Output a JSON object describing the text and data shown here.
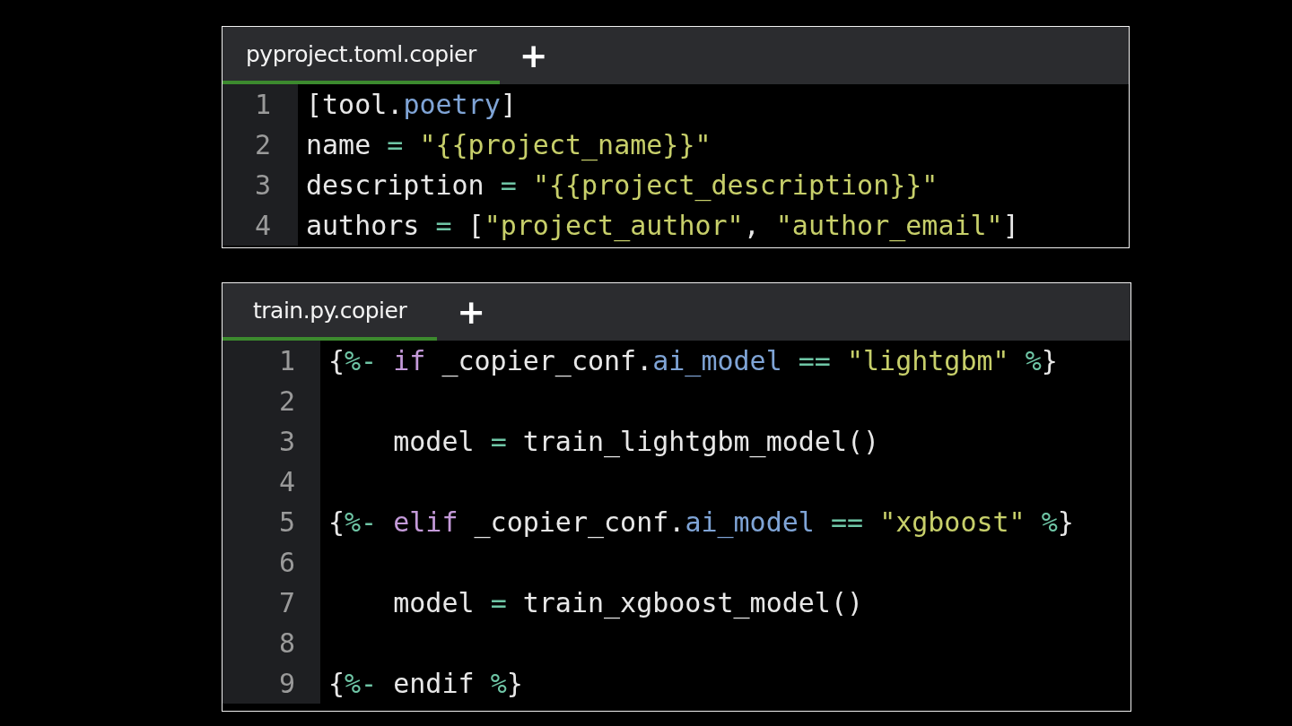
{
  "editors": [
    {
      "tabs": [
        {
          "label": "pyproject.toml.copier",
          "selected": true
        }
      ],
      "add_tab": "+",
      "lines": [
        {
          "number": "1",
          "tokens": [
            {
              "text": "[tool.",
              "kind": "plain"
            },
            {
              "text": "poetry",
              "kind": "prop"
            },
            {
              "text": "]",
              "kind": "plain"
            }
          ]
        },
        {
          "number": "2",
          "tokens": [
            {
              "text": "name ",
              "kind": "plain"
            },
            {
              "text": "= ",
              "kind": "op"
            },
            {
              "text": "\"{{project_name}}\"",
              "kind": "str"
            }
          ]
        },
        {
          "number": "3",
          "tokens": [
            {
              "text": "description ",
              "kind": "plain"
            },
            {
              "text": "= ",
              "kind": "op"
            },
            {
              "text": "\"{{project_description}}\"",
              "kind": "str"
            }
          ]
        },
        {
          "number": "4",
          "tokens": [
            {
              "text": "authors ",
              "kind": "plain"
            },
            {
              "text": "=",
              "kind": "op"
            },
            {
              "text": " [",
              "kind": "plain"
            },
            {
              "text": "\"project_author\"",
              "kind": "str"
            },
            {
              "text": ", ",
              "kind": "plain"
            },
            {
              "text": "\"author_email\"",
              "kind": "str"
            },
            {
              "text": "]",
              "kind": "plain"
            }
          ]
        }
      ]
    },
    {
      "tabs": [
        {
          "label": "train.py.copier",
          "selected": true
        }
      ],
      "add_tab": "+",
      "lines": [
        {
          "number": "1",
          "tokens": [
            {
              "text": "{",
              "kind": "plain"
            },
            {
              "text": "%- ",
              "kind": "op"
            },
            {
              "text": "if",
              "kind": "kw"
            },
            {
              "text": " _copier_conf.",
              "kind": "plain"
            },
            {
              "text": "ai_model",
              "kind": "prop"
            },
            {
              "text": " == ",
              "kind": "op"
            },
            {
              "text": "\"lightgbm\"",
              "kind": "str"
            },
            {
              "text": " %",
              "kind": "op"
            },
            {
              "text": "}",
              "kind": "plain"
            }
          ]
        },
        {
          "number": "2"
        },
        {
          "number": "3",
          "tokens": [
            {
              "text": "    model ",
              "kind": "plain"
            },
            {
              "text": "=",
              "kind": "op"
            },
            {
              "text": " train_lightgbm_model()",
              "kind": "plain"
            }
          ]
        },
        {
          "number": "4"
        },
        {
          "number": "5",
          "tokens": [
            {
              "text": "{",
              "kind": "plain"
            },
            {
              "text": "%- ",
              "kind": "op"
            },
            {
              "text": "elif",
              "kind": "kw"
            },
            {
              "text": " _copier_conf.",
              "kind": "plain"
            },
            {
              "text": "ai_model",
              "kind": "prop"
            },
            {
              "text": " == ",
              "kind": "op"
            },
            {
              "text": "\"xgboost\"",
              "kind": "str"
            },
            {
              "text": " %",
              "kind": "op"
            },
            {
              "text": "}",
              "kind": "plain"
            }
          ]
        },
        {
          "number": "6"
        },
        {
          "number": "7",
          "tokens": [
            {
              "text": "    model ",
              "kind": "plain"
            },
            {
              "text": "=",
              "kind": "op"
            },
            {
              "text": " train_xgboost_model()",
              "kind": "plain"
            }
          ]
        },
        {
          "number": "8"
        },
        {
          "number": "9",
          "tokens": [
            {
              "text": "{",
              "kind": "plain"
            },
            {
              "text": "%-",
              "kind": "op"
            },
            {
              "text": " endif ",
              "kind": "plain"
            },
            {
              "text": "%",
              "kind": "op"
            },
            {
              "text": "}",
              "kind": "plain"
            }
          ]
        }
      ]
    }
  ]
}
